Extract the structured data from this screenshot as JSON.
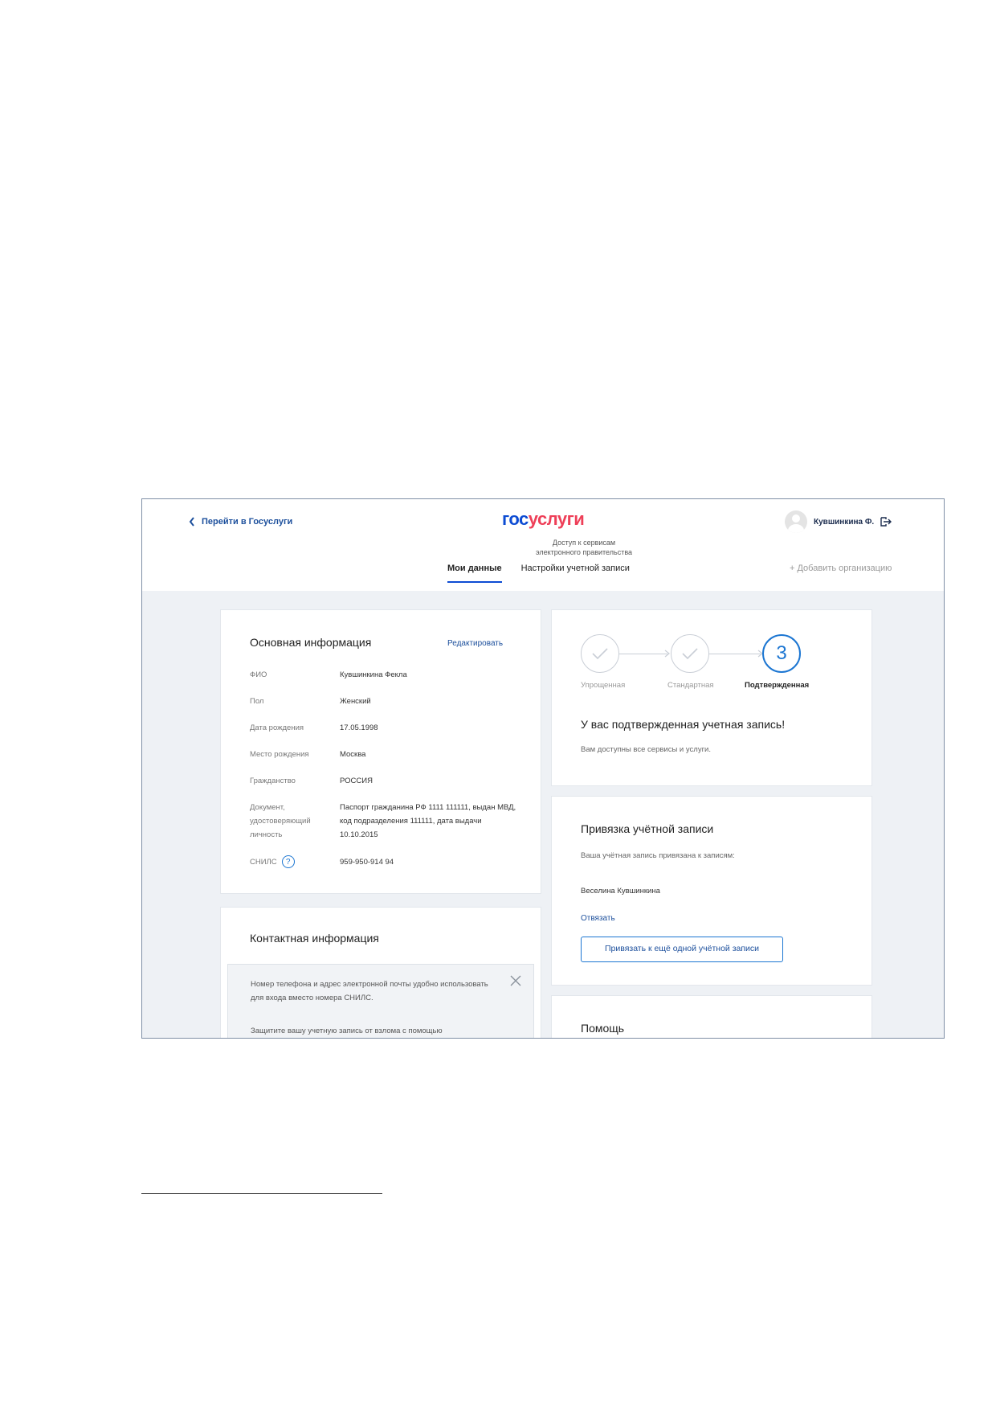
{
  "header": {
    "back_link": "Перейти в Госуслуги",
    "logo_gos": "гос",
    "logo_uslugi": "услуги",
    "tagline_line1": "Доступ к сервисам",
    "tagline_line2": "электронного правительства",
    "user_name": "Кувшинкина Ф.",
    "tabs": [
      {
        "label": "Мои данные",
        "active": true
      },
      {
        "label": "Настройки учетной записи",
        "active": false
      }
    ],
    "add_org": "+ Добавить организацию"
  },
  "main_info": {
    "title": "Основная информация",
    "edit": "Редактировать",
    "rows": [
      {
        "label": "ФИО",
        "value": "Кувшинкина Фекла"
      },
      {
        "label": "Пол",
        "value": "Женский"
      },
      {
        "label": "Дата рождения",
        "value": "17.05.1998"
      },
      {
        "label": "Место рождения",
        "value": "Москва"
      },
      {
        "label": "Гражданство",
        "value": "РОССИЯ"
      },
      {
        "label": "Документ, удостоверяющий личность",
        "value": "Паспорт гражданина РФ 1111 111111, выдан МВД, код подразделения 111111, дата выдачи 10.10.2015"
      },
      {
        "label": "СНИЛС",
        "value": "959-950-914 94"
      }
    ],
    "snils_help": "?"
  },
  "contact_info": {
    "title": "Контактная информация",
    "notice_line1": "Номер телефона и адрес электронной почты удобно использовать для входа вместо номера СНИЛС.",
    "notice_line2": "Защитите вашу учетную запись от взлома с помощью"
  },
  "status": {
    "steps": [
      {
        "label": "Упрощенная",
        "state": "done"
      },
      {
        "label": "Стандартная",
        "state": "done"
      },
      {
        "label": "Подтвержденная",
        "state": "current",
        "number": "3"
      }
    ],
    "title": "У вас подтвержденная учетная запись!",
    "description": "Вам доступны все сервисы и услуги."
  },
  "account_link": {
    "title": "Привязка учётной записи",
    "description": "Ваша учётная запись привязана к записям:",
    "linked_name": "Веселина Кувшинкина",
    "unlink": "Отвязать",
    "bind_button": "Привязать к ещё одной учётной записи"
  },
  "help": {
    "title": "Помощь"
  },
  "colors": {
    "accent": "#1c76d2",
    "logo_blue": "#0d4cd3",
    "logo_red": "#ee3f58",
    "background": "#eef1f5"
  }
}
